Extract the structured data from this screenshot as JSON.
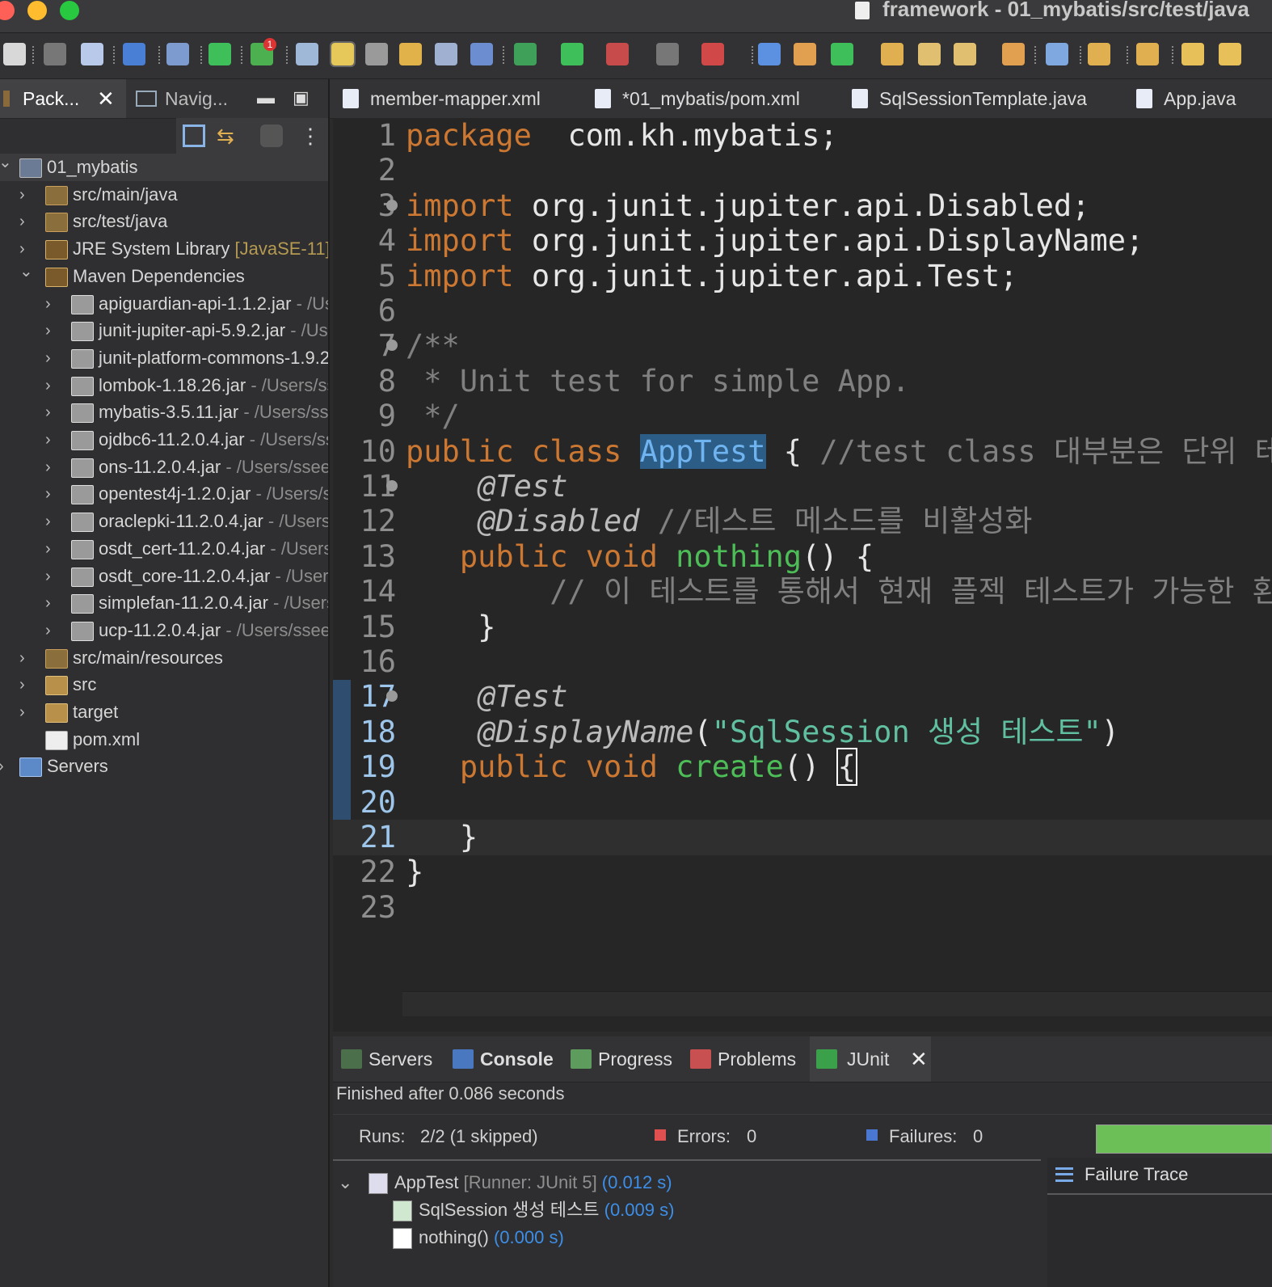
{
  "window": {
    "title": "framework - 01_mybatis/src/test/java"
  },
  "toolbar": {
    "icons": [
      "new-icon",
      "save-icon",
      "save-all-icon",
      "console-icon",
      "search-icon",
      "power-icon",
      "notification-icon",
      "run-config-icon",
      "highlight-icon",
      "gear-icon",
      "wrap-icon",
      "columns-icon",
      "pilcrow-icon",
      "debug-icon",
      "run-icon",
      "run-server-icon",
      "stop-icon",
      "terminate-icon",
      "deploy-icon",
      "package-icon",
      "refresh-icon",
      "open-folder-icon",
      "open-file-icon",
      "edit-icon",
      "open-project-icon",
      "globe-icon",
      "next-annotation-icon",
      "prev-annotation-icon",
      "back-icon",
      "forward-icon"
    ],
    "notification_count": "1"
  },
  "left_panel": {
    "tabs": [
      {
        "label": "Pack...",
        "active": true
      },
      {
        "label": "Navig...",
        "active": false
      }
    ],
    "tree": [
      {
        "label": "01_mybatis",
        "suffix": "",
        "level": 0,
        "expanded": true,
        "icon": "project-icon"
      },
      {
        "label": "src/main/java",
        "suffix": "",
        "level": 1,
        "expanded": false,
        "icon": "source-folder-icon"
      },
      {
        "label": "src/test/java",
        "suffix": "",
        "level": 1,
        "expanded": false,
        "icon": "source-folder-icon"
      },
      {
        "label": "JRE System Library ",
        "suffix": "[JavaSE-11]",
        "level": 1,
        "expanded": false,
        "icon": "library-icon"
      },
      {
        "label": "Maven Dependencies",
        "suffix": "",
        "level": 1,
        "expanded": true,
        "icon": "library-icon"
      },
      {
        "label": "apiguardian-api-1.1.2.jar",
        "suffix": " - /Users/ssee",
        "level": 2,
        "expanded": false,
        "icon": "jar-icon"
      },
      {
        "label": "junit-jupiter-api-5.9.2.jar",
        "suffix": " - /Users",
        "level": 2,
        "expanded": false,
        "icon": "jar-icon"
      },
      {
        "label": "junit-platform-commons-1.9.2.jar",
        "suffix": "",
        "level": 2,
        "expanded": false,
        "icon": "jar-icon"
      },
      {
        "label": "lombok-1.18.26.jar",
        "suffix": " - /Users/ssee",
        "level": 2,
        "expanded": false,
        "icon": "jar-icon"
      },
      {
        "label": "mybatis-3.5.11.jar",
        "suffix": " - /Users/ssee",
        "level": 2,
        "expanded": false,
        "icon": "jar-icon"
      },
      {
        "label": "ojdbc6-11.2.0.4.jar",
        "suffix": " - /Users/ssee",
        "level": 2,
        "expanded": false,
        "icon": "jar-icon"
      },
      {
        "label": "ons-11.2.0.4.jar",
        "suffix": " - /Users/ssee",
        "level": 2,
        "expanded": false,
        "icon": "jar-icon"
      },
      {
        "label": "opentest4j-1.2.0.jar",
        "suffix": " - /Users/ssee",
        "level": 2,
        "expanded": false,
        "icon": "jar-icon"
      },
      {
        "label": "oraclepki-11.2.0.4.jar",
        "suffix": " - /Users/ssee",
        "level": 2,
        "expanded": false,
        "icon": "jar-icon"
      },
      {
        "label": "osdt_cert-11.2.0.4.jar",
        "suffix": " - /Users/ssee",
        "level": 2,
        "expanded": false,
        "icon": "jar-icon"
      },
      {
        "label": "osdt_core-11.2.0.4.jar",
        "suffix": " - /Users/ssee",
        "level": 2,
        "expanded": false,
        "icon": "jar-icon"
      },
      {
        "label": "simplefan-11.2.0.4.jar",
        "suffix": " - /Users/ssee",
        "level": 2,
        "expanded": false,
        "icon": "jar-icon"
      },
      {
        "label": "ucp-11.2.0.4.jar",
        "suffix": " - /Users/ssee",
        "level": 2,
        "expanded": false,
        "icon": "jar-icon"
      },
      {
        "label": "src/main/resources",
        "suffix": "",
        "level": 1,
        "expanded": false,
        "icon": "source-folder-icon"
      },
      {
        "label": "src",
        "suffix": "",
        "level": 1,
        "expanded": false,
        "icon": "folder-icon"
      },
      {
        "label": "target",
        "suffix": "",
        "level": 1,
        "expanded": false,
        "icon": "folder-icon"
      },
      {
        "label": "pom.xml",
        "suffix": "",
        "level": 1,
        "expanded": null,
        "icon": "maven-file-icon"
      },
      {
        "label": "Servers",
        "suffix": "",
        "level": 0,
        "expanded": false,
        "icon": "servers-folder-icon"
      }
    ]
  },
  "editor": {
    "tabs": [
      {
        "label": "member-mapper.xml",
        "icon": "xml-file-icon"
      },
      {
        "label": "*01_mybatis/pom.xml",
        "icon": "maven-file-icon"
      },
      {
        "label": "SqlSessionTemplate.java",
        "icon": "java-file-icon"
      },
      {
        "label": "App.java",
        "icon": "java-file-icon"
      }
    ],
    "lines": [
      {
        "n": "1",
        "seg": [
          [
            "kw",
            "package"
          ],
          [
            "",
            "  com.kh.mybatis;"
          ]
        ]
      },
      {
        "n": "2",
        "seg": []
      },
      {
        "n": "3",
        "fold": true,
        "seg": [
          [
            "kw",
            "import"
          ],
          [
            "",
            " org.junit.jupiter.api.Disabled;"
          ]
        ]
      },
      {
        "n": "4",
        "seg": [
          [
            "kw",
            "import"
          ],
          [
            "",
            " org.junit.jupiter.api.DisplayName;"
          ]
        ]
      },
      {
        "n": "5",
        "seg": [
          [
            "kw",
            "import"
          ],
          [
            "",
            " org.junit.jupiter.api.Test;"
          ]
        ]
      },
      {
        "n": "6",
        "seg": []
      },
      {
        "n": "7",
        "fold": true,
        "seg": [
          [
            "cm",
            "/**"
          ]
        ]
      },
      {
        "n": "8",
        "seg": [
          [
            "cm",
            " * Unit test for simple App."
          ]
        ]
      },
      {
        "n": "9",
        "seg": [
          [
            "cm",
            " */"
          ]
        ]
      },
      {
        "n": "10",
        "seg": [
          [
            "kw",
            "public class"
          ],
          [
            "",
            " "
          ],
          [
            "sel",
            "AppTest"
          ],
          [
            "",
            " { "
          ],
          [
            "cm",
            "//test class 대부분은 단위 테스트"
          ]
        ]
      },
      {
        "n": "11",
        "fold": true,
        "seg": [
          [
            "an",
            "    @Test"
          ]
        ]
      },
      {
        "n": "12",
        "seg": [
          [
            "an",
            "    @Disabled"
          ],
          [
            "cm",
            " //테스트 메소드를 비활성화"
          ]
        ]
      },
      {
        "n": "13",
        "seg": [
          [
            "kw",
            "   public void"
          ],
          [
            "",
            " "
          ],
          [
            "fn",
            "nothing"
          ],
          [
            "",
            "() {"
          ]
        ]
      },
      {
        "n": "14",
        "seg": [
          [
            "cm",
            "        // 이 테스트를 통해서 현재 플젝 테스트가 가능한 환경인지"
          ]
        ]
      },
      {
        "n": "15",
        "seg": [
          [
            "",
            "    }"
          ]
        ]
      },
      {
        "n": "16",
        "seg": []
      },
      {
        "n": "17",
        "fold": true,
        "seg": [
          [
            "an",
            "    @Test"
          ]
        ]
      },
      {
        "n": "18",
        "seg": [
          [
            "an",
            "    @DisplayName"
          ],
          [
            "",
            "("
          ],
          [
            "str",
            "\"SqlSession 생성 테스트\""
          ],
          [
            "",
            ")"
          ]
        ]
      },
      {
        "n": "19",
        "seg": [
          [
            "kw",
            "   public void"
          ],
          [
            "",
            " "
          ],
          [
            "fn",
            "create"
          ],
          [
            "",
            "() "
          ],
          [
            "caret",
            "{"
          ]
        ]
      },
      {
        "n": "20",
        "seg": []
      },
      {
        "n": "21",
        "current": true,
        "seg": [
          [
            "",
            "   }"
          ]
        ]
      },
      {
        "n": "22",
        "seg": [
          [
            "",
            "}"
          ]
        ]
      },
      {
        "n": "23",
        "seg": []
      }
    ]
  },
  "bottom_panel": {
    "tabs": [
      {
        "label": "Servers",
        "icon": "servers-icon"
      },
      {
        "label": "Console",
        "icon": "console-icon"
      },
      {
        "label": "Progress",
        "icon": "progress-icon"
      },
      {
        "label": "Problems",
        "icon": "problems-icon"
      },
      {
        "label": "JUnit",
        "icon": "junit-icon",
        "active": true
      }
    ],
    "finished": "Finished after 0.086 seconds",
    "runs_label": "Runs:",
    "runs_value": "2/2 (1 skipped)",
    "errors_label": "Errors:",
    "errors_value": "0",
    "failures_label": "Failures:",
    "failures_value": "0",
    "progress": 1.0,
    "progress_color": "#6cbe56",
    "results": [
      {
        "name": "AppTest",
        "runner": " [Runner: JUnit 5]",
        "time": " (0.012 s)"
      },
      {
        "name": "SqlSession 생성 테스트",
        "runner": "",
        "time": " (0.009 s)"
      },
      {
        "name": "nothing()",
        "runner": "",
        "time": " (0.000 s)"
      }
    ],
    "failure_trace_label": "Failure Trace"
  }
}
